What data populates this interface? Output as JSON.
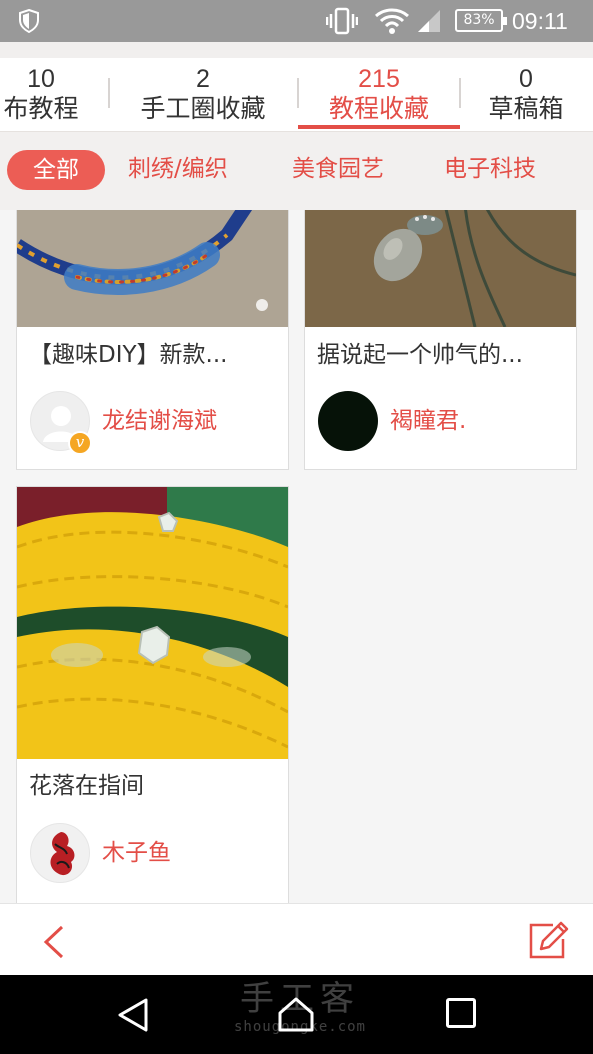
{
  "status_bar": {
    "battery": "83%",
    "time": "09:11",
    "icons": [
      "shield-icon",
      "vibrate-icon",
      "wifi-icon",
      "signal-icon",
      "battery-icon"
    ]
  },
  "stats_tabs": [
    {
      "count": "10",
      "label": "布教程",
      "active": false
    },
    {
      "count": "2",
      "label": "手工圈收藏",
      "active": false
    },
    {
      "count": "215",
      "label": "教程收藏",
      "active": true
    },
    {
      "count": "0",
      "label": "草稿箱",
      "active": false
    }
  ],
  "categories": {
    "selected": "全部",
    "items": [
      "刺绣/编织",
      "美食园艺",
      "电子科技"
    ]
  },
  "cards": [
    {
      "title": "【趣味DIY】新款...",
      "author": "龙结谢海斌",
      "verified": true
    },
    {
      "title": "据说起一个帅气的...",
      "author": "褐瞳君.",
      "verified": false
    },
    {
      "title": "花落在指间",
      "author": "木子鱼",
      "verified": false
    }
  ],
  "bottom_bar": {
    "icons": [
      "back-icon",
      "edit-icon"
    ]
  },
  "watermark": {
    "cn": "手工客",
    "en": "shougongke.com"
  },
  "colors": {
    "accent": "#e34e47",
    "pill": "#ec5d55",
    "status_bar": "#999999",
    "nav_bar": "#000000"
  }
}
